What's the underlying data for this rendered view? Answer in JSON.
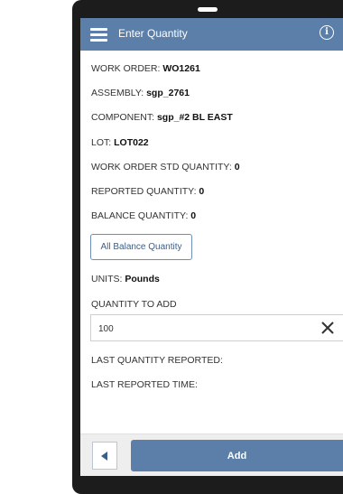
{
  "header": {
    "title": "Enter Quantity",
    "menu_icon": "hamburger-menu-icon",
    "info_icon": "info-icon",
    "info_glyph": "i"
  },
  "fields": {
    "work_order": {
      "label": "WORK ORDER:",
      "value": "WO1261"
    },
    "assembly": {
      "label": "ASSEMBLY:",
      "value": "sgp_2761"
    },
    "component": {
      "label": "COMPONENT:",
      "value": "sgp_#2 BL EAST"
    },
    "lot": {
      "label": "LOT:",
      "value": "LOT022"
    },
    "wo_std_qty": {
      "label": "WORK ORDER STD QUANTITY:",
      "value": "0"
    },
    "reported_qty": {
      "label": "REPORTED QUANTITY:",
      "value": "0"
    },
    "balance_qty": {
      "label": "BALANCE QUANTITY:",
      "value": "0"
    },
    "units": {
      "label": "UNITS:",
      "value": "Pounds"
    },
    "qty_to_add": {
      "label": "QUANTITY TO ADD"
    },
    "last_qty_reported": {
      "label": "LAST QUANTITY REPORTED:",
      "value": ""
    },
    "last_reported_time": {
      "label": "LAST REPORTED TIME:",
      "value": ""
    }
  },
  "buttons": {
    "all_balance": "All Balance Quantity",
    "add": "Add",
    "back_icon": "back-arrow-icon"
  },
  "input": {
    "quantity_value": "100",
    "clear_icon": "close-icon"
  },
  "colors": {
    "accent": "#5b7fa8",
    "device_frame": "#1c1c1c",
    "footer_bg": "#eeeeee"
  }
}
